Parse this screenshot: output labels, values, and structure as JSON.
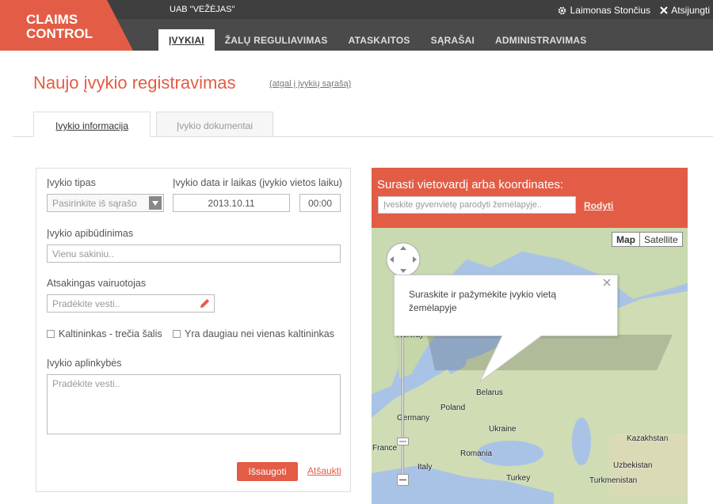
{
  "header": {
    "logo_line1": "CLAIMS",
    "logo_line2": "CONTROL",
    "company": "UAB \"VEŽĖJAS\"",
    "user_name": "Laimonas Stončius",
    "logout_label": "Atsijungti",
    "nav": [
      {
        "label": "ĮVYKIAI",
        "active": true
      },
      {
        "label": "ŽALŲ REGULIAVIMAS"
      },
      {
        "label": "ATASKAITOS"
      },
      {
        "label": "SĄRAŠAI"
      },
      {
        "label": "ADMINISTRAVIMAS"
      }
    ]
  },
  "page": {
    "title": "Naujo įvykio registravimas",
    "back_link": "(atgal į įvykių sąrašą)"
  },
  "tabs": [
    {
      "label": "Įvykio informacija",
      "active": true
    },
    {
      "label": "Įvykio dokumentai"
    }
  ],
  "form": {
    "type_label": "Įvykio tipas",
    "type_placeholder": "Pasirinkite iš sąrašo",
    "date_label": "Įvykio data ir laikas (įvykio vietos laiku)",
    "date_value": "2013.10.11",
    "time_value": "00:00",
    "description_label": "Įvykio apibūdinimas",
    "description_placeholder": "Vienu sakiniu..",
    "driver_label": "Atsakingas vairuotojas",
    "driver_placeholder": "Pradėkite vesti..",
    "chk_third_party": "Kaltininkas - trečia šalis",
    "chk_multiple": "Yra daugiau nei vienas kaltininkas",
    "circumstances_label": "Įvykio aplinkybės",
    "circumstances_placeholder": "Pradėkite vesti..",
    "save_label": "Išsaugoti",
    "cancel_label": "Atšaukti"
  },
  "map": {
    "title": "Surasti vietovardį arba koordinates:",
    "search_placeholder": "Įveskite gyvenvietę parodyti žemėlapyje..",
    "show_label": "Rodyti",
    "type_map": "Map",
    "type_satellite": "Satellite",
    "bubble_text": "Suraskite ir pažymėkite įvykio vietą žemėlapyje",
    "labels": {
      "norway": "Norway",
      "belarus": "Belarus",
      "poland": "Poland",
      "germany": "Germany",
      "ukraine": "Ukraine",
      "kazakhstan": "Kazakhstan",
      "france": "France",
      "romania": "Romania",
      "italy": "Italy",
      "uzbekistan": "Uzbekistan",
      "turkey": "Turkey",
      "turkmenistan": "Turkmenistan"
    }
  },
  "colors": {
    "brand": "#e35c45",
    "header_bg": "#4a4a4a"
  }
}
